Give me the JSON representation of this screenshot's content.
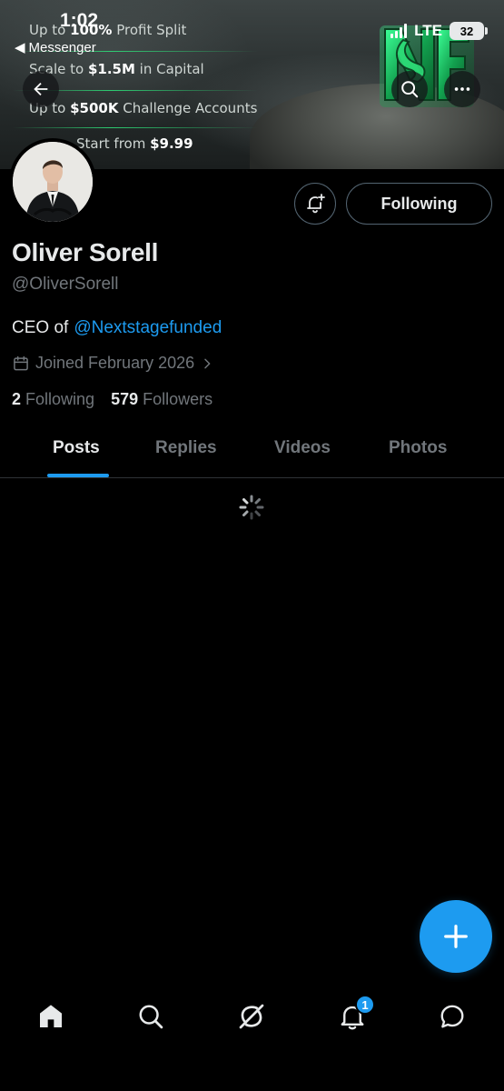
{
  "status_bar": {
    "time": "1:02",
    "back_app": "Messenger",
    "network": "LTE",
    "battery": "32"
  },
  "banner": {
    "promo_lines": [
      {
        "pre": "Up to ",
        "bold": "100%",
        "post": " Profit Split"
      },
      {
        "pre": "Scale to ",
        "bold": "$1.5M",
        "post": " in Capital"
      },
      {
        "pre": "Up to ",
        "bold": "$500K",
        "post": " Challenge Accounts"
      },
      {
        "pre": "Start from ",
        "bold": "$9.99",
        "post": ""
      }
    ],
    "logo_text": "NSF",
    "accent_color": "#2edc78"
  },
  "profile": {
    "display_name": "Oliver Sorell",
    "handle": "@OliverSorell",
    "bio_prefix": "CEO of",
    "bio_mention": "@Nextstagefunded",
    "joined": "Joined February 2026",
    "following_count": "2",
    "following_label": "Following",
    "followers_count": "579",
    "followers_label": "Followers",
    "follow_button_label": "Following"
  },
  "tabs": [
    {
      "label": "Posts",
      "active": true
    },
    {
      "label": "Replies",
      "active": false
    },
    {
      "label": "Videos",
      "active": false
    },
    {
      "label": "Photos",
      "active": false
    }
  ],
  "nav": {
    "items": [
      "home-icon",
      "search-icon",
      "grok-icon",
      "notifications-icon",
      "messages-icon"
    ],
    "notifications_badge": "1"
  },
  "colors": {
    "accent": "#1d9bf0",
    "background": "#000000",
    "secondary_text": "#71767b",
    "primary_text": "#e7e9ea"
  }
}
